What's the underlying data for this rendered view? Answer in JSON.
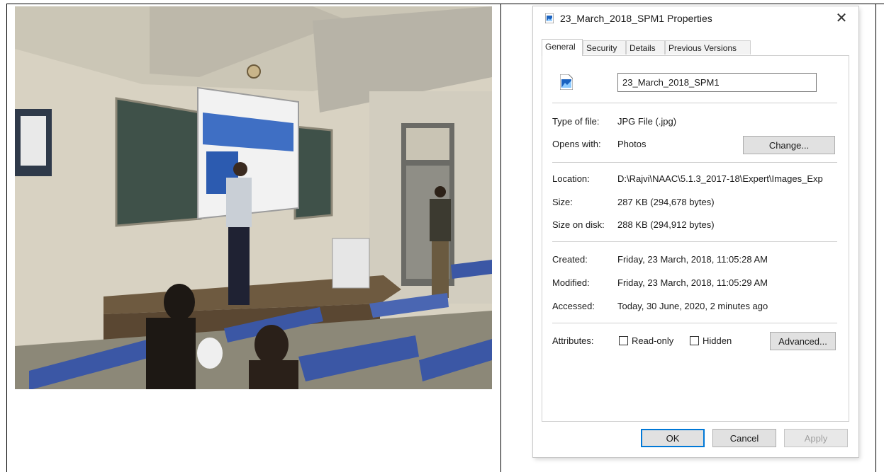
{
  "photo": {
    "description_icon": "classroom-photo"
  },
  "dialog": {
    "title": "23_March_2018_SPM1 Properties",
    "close_glyph": "✕",
    "tabs": [
      "General",
      "Security",
      "Details",
      "Previous Versions"
    ],
    "active_tab": "General",
    "file_name": "23_March_2018_SPM1",
    "type_of_file": {
      "label": "Type of file:",
      "value": "JPG File (.jpg)"
    },
    "opens_with": {
      "label": "Opens with:",
      "value": "Photos",
      "button": "Change..."
    },
    "location": {
      "label": "Location:",
      "value": "D:\\Rajvi\\NAAC\\5.1.3_2017-18\\Expert\\Images_Exp"
    },
    "size": {
      "label": "Size:",
      "value": "287 KB (294,678 bytes)"
    },
    "size_on_disk": {
      "label": "Size on disk:",
      "value": "288 KB (294,912 bytes)"
    },
    "created": {
      "label": "Created:",
      "value": "Friday, 23 March, 2018, 11:05:28 AM"
    },
    "modified": {
      "label": "Modified:",
      "value": "Friday, 23 March, 2018, 11:05:29 AM"
    },
    "accessed": {
      "label": "Accessed:",
      "value": "Today, 30 June, 2020, 2 minutes ago"
    },
    "attributes": {
      "label": "Attributes:",
      "read_only": "Read-only",
      "hidden": "Hidden",
      "advanced": "Advanced..."
    },
    "buttons": {
      "ok": "OK",
      "cancel": "Cancel",
      "apply": "Apply"
    },
    "colors": {
      "accent": "#0078d7"
    }
  }
}
